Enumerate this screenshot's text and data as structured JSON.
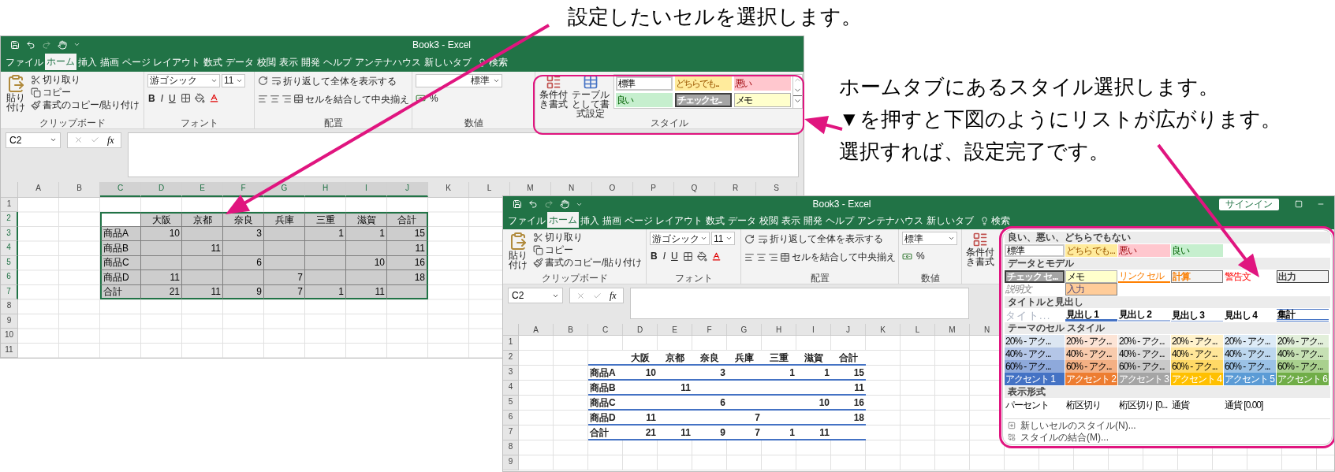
{
  "annotations": [
    {
      "lines": [
        "設定したいセルを選択します。"
      ]
    },
    {
      "lines": [
        "ホームタブにあるスタイル選択します。",
        "▼を押すと下図のようにリストが広がります。",
        "選択すれば、設定完了です。"
      ]
    }
  ],
  "windows": [
    {
      "title": "Book3 - Excel",
      "tabs": [
        {
          "label": "ファイル",
          "selected": false
        },
        {
          "label": "ホーム",
          "selected": true
        },
        {
          "label": "挿入",
          "selected": false
        },
        {
          "label": "描画",
          "selected": false
        },
        {
          "label": "ページ レイアウト",
          "selected": false
        },
        {
          "label": "数式",
          "selected": false
        },
        {
          "label": "データ",
          "selected": false
        },
        {
          "label": "校閲",
          "selected": false
        },
        {
          "label": "表示",
          "selected": false
        },
        {
          "label": "開発",
          "selected": false
        },
        {
          "label": "ヘルプ",
          "selected": false
        },
        {
          "label": "アンテナハウス",
          "selected": false
        },
        {
          "label": "新しいタブ",
          "selected": false
        }
      ],
      "search": "検索",
      "ribbon": {
        "clipboard": {
          "paste": "貼り付け",
          "cut": "切り取り",
          "copy": "コピー",
          "format_painter": "書式のコピー/貼り付け",
          "label": "クリップボード"
        },
        "font": {
          "name": "游ゴシック",
          "size": "11",
          "bold": "B",
          "italic": "I",
          "underline": "U",
          "label": "フォント"
        },
        "alignment": {
          "wrap": "折り返して全体を表示する",
          "merge": "セルを結合して中央揃え",
          "label": "配置"
        },
        "number": {
          "format": "標準",
          "percent": "%",
          "label": "数値"
        },
        "styles": {
          "conditional": "条件付き書式",
          "table_format": "テーブルとして書式設定",
          "label": "スタイル",
          "cells": [
            {
              "label": "標準",
              "kind": "normal"
            },
            {
              "label": "どちらでも...",
              "kind": "neutral"
            },
            {
              "label": "悪い",
              "kind": "bad"
            },
            {
              "label": "良い",
              "kind": "good"
            },
            {
              "label": "チェック セ...",
              "kind": "check"
            },
            {
              "label": "メモ",
              "kind": "note"
            }
          ]
        }
      },
      "name_box": "C2",
      "fx": "fx",
      "columns": [
        "A",
        "B",
        "C",
        "D",
        "E",
        "F",
        "G",
        "H",
        "I",
        "J",
        "K",
        "L",
        "M",
        "N",
        "O",
        "P",
        "Q",
        "R",
        "S"
      ],
      "row_numbers": [
        "1",
        "2",
        "3",
        "4",
        "5",
        "6",
        "7",
        "8",
        "9",
        "10",
        "11"
      ],
      "table": {
        "selected": true,
        "styled": false,
        "rows": [
          [
            null,
            "大阪",
            "京都",
            "奈良",
            "兵庫",
            "三重",
            "滋賀",
            "合計"
          ],
          [
            "商品A",
            "10",
            null,
            "3",
            null,
            "1",
            "1",
            "15"
          ],
          [
            "商品B",
            null,
            "11",
            null,
            null,
            null,
            null,
            "11"
          ],
          [
            "商品C",
            null,
            null,
            "6",
            null,
            null,
            "10",
            "16"
          ],
          [
            "商品D",
            "11",
            null,
            null,
            "7",
            null,
            null,
            "18"
          ],
          [
            "合計",
            "21",
            "11",
            "9",
            "7",
            "1",
            "11",
            null
          ]
        ]
      }
    },
    {
      "title": "Book3 - Excel",
      "sign_in": "サインイン",
      "tabs": [
        {
          "label": "ファイル",
          "selected": false
        },
        {
          "label": "ホーム",
          "selected": true
        },
        {
          "label": "挿入",
          "selected": false
        },
        {
          "label": "描画",
          "selected": false
        },
        {
          "label": "ページ レイアウト",
          "selected": false
        },
        {
          "label": "数式",
          "selected": false
        },
        {
          "label": "データ",
          "selected": false
        },
        {
          "label": "校閲",
          "selected": false
        },
        {
          "label": "表示",
          "selected": false
        },
        {
          "label": "開発",
          "selected": false
        },
        {
          "label": "ヘルプ",
          "selected": false
        },
        {
          "label": "アンテナハウス",
          "selected": false
        },
        {
          "label": "新しいタブ",
          "selected": false
        }
      ],
      "search": "検索",
      "ribbon": {
        "clipboard": {
          "paste": "貼り付け",
          "cut": "切り取り",
          "copy": "コピー",
          "format_painter": "書式のコピー/貼り付け",
          "label": "クリップボード"
        },
        "font": {
          "name": "游ゴシック",
          "size": "11",
          "bold": "B",
          "italic": "I",
          "underline": "U",
          "label": "フォント"
        },
        "alignment": {
          "wrap": "折り返して全体を表示する",
          "merge": "セルを結合して中央揃え",
          "label": "配置"
        },
        "number": {
          "format": "標準",
          "percent": "%",
          "label": "数値"
        },
        "styles": {
          "conditional": "条件付き書式"
        }
      },
      "name_box": "C2",
      "fx": "fx",
      "columns": [
        "A",
        "B",
        "C",
        "D",
        "E",
        "F",
        "G",
        "H",
        "I",
        "J",
        "K",
        "L",
        "M",
        "N"
      ],
      "row_numbers": [
        "1",
        "2",
        "3",
        "4",
        "5",
        "6",
        "7",
        "8",
        "9"
      ],
      "table": {
        "selected": false,
        "styled": true,
        "rows": [
          [
            null,
            "大阪",
            "京都",
            "奈良",
            "兵庫",
            "三重",
            "滋賀",
            "合計"
          ],
          [
            "商品A",
            "10",
            null,
            "3",
            null,
            "1",
            "1",
            "15"
          ],
          [
            "商品B",
            null,
            "11",
            null,
            null,
            null,
            null,
            "11"
          ],
          [
            "商品C",
            null,
            null,
            "6",
            null,
            null,
            "10",
            "16"
          ],
          [
            "商品D",
            "11",
            null,
            null,
            "7",
            null,
            null,
            "18"
          ],
          [
            "合計",
            "21",
            "11",
            "9",
            "7",
            "1",
            "11",
            null
          ]
        ]
      },
      "gallery": {
        "sections": [
          {
            "heading": "良い、悪い、どちらでもない",
            "items": [
              {
                "label": "標準",
                "kind": "normal"
              },
              {
                "label": "どちらでも...",
                "kind": "neutral"
              },
              {
                "label": "悪い",
                "kind": "bad"
              },
              {
                "label": "良い",
                "kind": "good"
              }
            ]
          },
          {
            "heading": "データとモデル",
            "items": [
              {
                "label": "チェック セ...",
                "kind": "check"
              },
              {
                "label": "メモ",
                "kind": "note"
              },
              {
                "label": "リンク セル",
                "kind": "link"
              },
              {
                "label": "計算",
                "kind": "calc"
              },
              {
                "label": "警告文",
                "kind": "warning"
              },
              {
                "label": "出力",
                "kind": "output"
              },
              {
                "label": "説明文",
                "kind": "explanatory"
              },
              {
                "label": "入力",
                "kind": "input"
              }
            ]
          },
          {
            "heading": "タイトルと見出し",
            "items": [
              {
                "label": "タイト...",
                "kind": "title"
              },
              {
                "label": "見出し 1",
                "kind": "heading1"
              },
              {
                "label": "見出し 2",
                "kind": "heading2"
              },
              {
                "label": "見出し 3",
                "kind": "heading3"
              },
              {
                "label": "見出し 4",
                "kind": "heading4"
              },
              {
                "label": "集計",
                "kind": "total"
              }
            ]
          },
          {
            "heading": "テーマのセル スタイル",
            "items": [
              {
                "label": "20% - アク...",
                "kind": "tint",
                "color": "#dce6f2"
              },
              {
                "label": "20% - アク...",
                "kind": "tint",
                "color": "#fce4d6"
              },
              {
                "label": "20% - アク...",
                "kind": "tint",
                "color": "#ededed"
              },
              {
                "label": "20% - アク...",
                "kind": "tint",
                "color": "#fff2cc"
              },
              {
                "label": "20% - アク...",
                "kind": "tint",
                "color": "#ddebf7"
              },
              {
                "label": "20% - アク...",
                "kind": "tint",
                "color": "#e2efda"
              },
              {
                "label": "40% - アク...",
                "kind": "tint",
                "color": "#b4c6e7"
              },
              {
                "label": "40% - アク...",
                "kind": "tint",
                "color": "#f8cbad"
              },
              {
                "label": "40% - アク...",
                "kind": "tint",
                "color": "#dbdbdb"
              },
              {
                "label": "40% - アク...",
                "kind": "tint",
                "color": "#ffe699"
              },
              {
                "label": "40% - アク...",
                "kind": "tint",
                "color": "#bdd7ee"
              },
              {
                "label": "40% - アク...",
                "kind": "tint",
                "color": "#c6e0b4"
              },
              {
                "label": "60% - アク...",
                "kind": "tint",
                "color": "#8ea9db"
              },
              {
                "label": "60% - アク...",
                "kind": "tint",
                "color": "#f4b084"
              },
              {
                "label": "60% - アク...",
                "kind": "tint",
                "color": "#c9c9c9"
              },
              {
                "label": "60% - アク...",
                "kind": "tint",
                "color": "#ffd966"
              },
              {
                "label": "60% - アク...",
                "kind": "tint",
                "color": "#9bc2e6"
              },
              {
                "label": "60% - アク...",
                "kind": "tint",
                "color": "#a9d08e"
              },
              {
                "label": "アクセント 1",
                "kind": "accent",
                "color": "#4472c4"
              },
              {
                "label": "アクセント 2",
                "kind": "accent",
                "color": "#ed7d31"
              },
              {
                "label": "アクセント 3",
                "kind": "accent",
                "color": "#a5a5a5"
              },
              {
                "label": "アクセント 4",
                "kind": "accent",
                "color": "#ffc000"
              },
              {
                "label": "アクセント 5",
                "kind": "accent",
                "color": "#5b9bd5"
              },
              {
                "label": "アクセント 6",
                "kind": "accent",
                "color": "#70ad47"
              }
            ]
          },
          {
            "heading": "表示形式",
            "items": [
              {
                "label": "パーセント",
                "kind": "format"
              },
              {
                "label": "桁区切り",
                "kind": "format"
              },
              {
                "label": "桁区切り [0...",
                "kind": "format"
              },
              {
                "label": "通貨",
                "kind": "format"
              },
              {
                "label": "通貨 [0.00]",
                "kind": "format"
              }
            ]
          }
        ],
        "menu": [
          {
            "label": "新しいセルのスタイル(N)..."
          },
          {
            "label": "スタイルの結合(M)..."
          }
        ]
      }
    }
  ]
}
